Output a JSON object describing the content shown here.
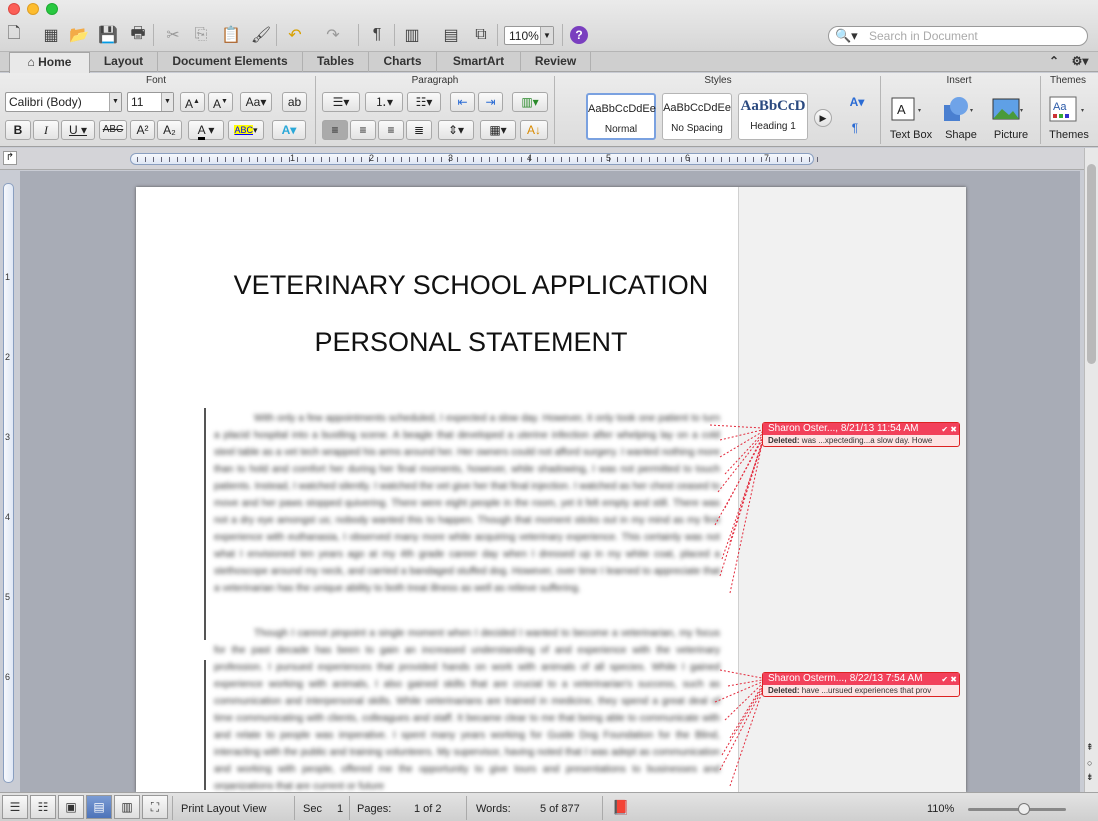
{
  "toolbar": {
    "zoom": "110%",
    "search_placeholder": "Search in Document"
  },
  "tabs": [
    "Home",
    "Layout",
    "Document Elements",
    "Tables",
    "Charts",
    "SmartArt",
    "Review"
  ],
  "ribbon": {
    "groups": {
      "font": "Font",
      "paragraph": "Paragraph",
      "styles": "Styles",
      "insert": "Insert",
      "themes": "Themes"
    },
    "font_name": "Calibri (Body)",
    "font_size": "11",
    "styles": [
      {
        "preview": "AaBbCcDdEe",
        "name": "Normal"
      },
      {
        "preview": "AaBbCcDdEe",
        "name": "No Spacing"
      },
      {
        "preview": "AaBbCcD",
        "name": "Heading 1"
      }
    ],
    "insert_items": [
      "Text Box",
      "Shape",
      "Picture"
    ],
    "themes_label": "Themes"
  },
  "ruler": {
    "numbers": [
      "1",
      "2",
      "3",
      "4",
      "5",
      "6",
      "7"
    ],
    "vnumbers": [
      "1",
      "2",
      "3",
      "4",
      "5",
      "6"
    ]
  },
  "document": {
    "title_line1": "VETERINARY SCHOOL APPLICATION",
    "title_line2": "PERSONAL STATEMENT",
    "para1": "With only a few appointments scheduled, I expected a slow day. However, it only took one patient to turn a placid hospital into a bustling scene. A beagle that developed a uterine infection after whelping lay on a cold steel table as a vet tech wrapped his arms around her. Her owners could not afford surgery. I wanted nothing more than to hold and comfort her during her final moments, however, while shadowing, I was not permitted to touch patients. Instead, I watched silently. I watched the vet give her that final injection. I watched as her chest ceased to move and her paws stopped quivering. There were eight people in the room, yet it felt empty and still. There was not a dry eye amongst us; nobody wanted this to happen. Though that moment sticks out in my mind as my first experience with euthanasia, I observed many more while acquiring veterinary experience. This certainly was not what I envisioned ten years ago at my 4th grade career day when I dressed up in my white coat, placed a stethoscope around my neck, and carried a bandaged stuffed dog. However, over time I learned to appreciate that a veterinarian has the unique ability to both treat illness as well as relieve suffering.",
    "para2": "Though I cannot pinpoint a single moment when I decided I wanted to become a veterinarian, my focus for the past decade has been to gain an increased understanding of and experience with the veterinary profession. I pursued experiences that provided hands on work with animals of all species. While I gained experience working with animals, I also gained skills that are crucial to a veterinarian's success, such as communication and interpersonal skills. While veterinarians are trained in medicine, they spend a great deal of time communicating with clients, colleagues and staff. It became clear to me that being able to communicate with and relate to people was imperative. I spent many years working for Guide Dog Foundation for the Blind, interacting with the public and training volunteers. My supervisor, having noted that I was adept as communication and working with people, offered me the opportunity to give tours and presentations to businesses and organizations that are current or future"
  },
  "comments": [
    {
      "header": "Sharon Oster..., 8/21/13 11:54 AM",
      "label": "Deleted:",
      "text": "was ...xpecteding...a slow day. Howe"
    },
    {
      "header": "Sharon Osterm..., 8/22/13 7:54 AM",
      "label": "Deleted:",
      "text": "have ...ursued experiences that prov"
    }
  ],
  "status": {
    "view": "Print Layout View",
    "sec_label": "Sec",
    "sec_value": "1",
    "pages_label": "Pages:",
    "pages_value": "1 of 2",
    "words_label": "Words:",
    "words_value": "5 of 877",
    "zoom": "110%"
  },
  "colors": {
    "accent": "#f2415b",
    "comment_bg": "#fde4e4"
  }
}
